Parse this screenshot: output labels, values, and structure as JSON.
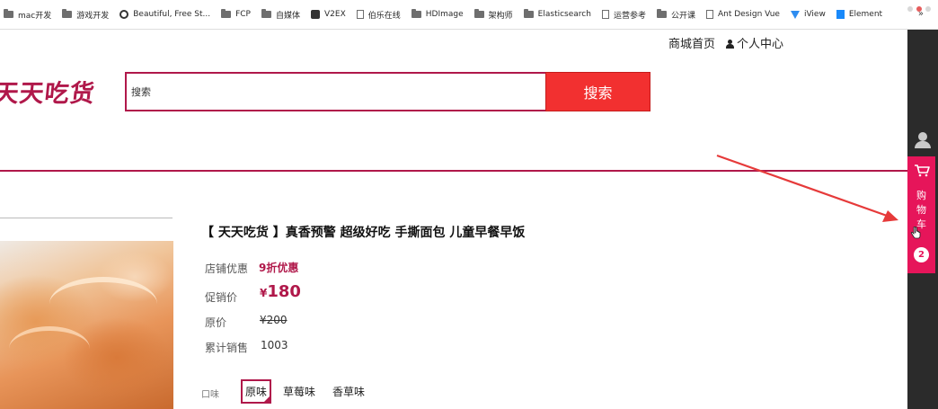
{
  "bookmarks": [
    {
      "label": "mac开发",
      "icon": "folder-icon"
    },
    {
      "label": "游戏开发",
      "icon": "folder-icon"
    },
    {
      "label": "Beautiful, Free St...",
      "icon": "ring-icon"
    },
    {
      "label": "FCP",
      "icon": "folder-icon"
    },
    {
      "label": "自媒体",
      "icon": "folder-icon"
    },
    {
      "label": "V2EX",
      "icon": "v2ex-icon"
    },
    {
      "label": "伯乐在线",
      "icon": "page-icon"
    },
    {
      "label": "HDImage",
      "icon": "folder-icon"
    },
    {
      "label": "架构师",
      "icon": "folder-icon"
    },
    {
      "label": "Elasticsearch",
      "icon": "folder-icon"
    },
    {
      "label": "运营参考",
      "icon": "page-icon"
    },
    {
      "label": "公开课",
      "icon": "folder-icon"
    },
    {
      "label": "Ant Design Vue",
      "icon": "page-icon"
    },
    {
      "label": "iView",
      "icon": "vue-icon"
    },
    {
      "label": "Element",
      "icon": "cube-icon"
    }
  ],
  "bookmarks_more": "»",
  "header": {
    "mall_home": "商城首页",
    "personal_center": "个人中心"
  },
  "logo": {
    "text": "天天吃货"
  },
  "search": {
    "placeholder": "搜索",
    "button": "搜索"
  },
  "product": {
    "title": "【 天天吃货 】真香预警 超级好吃 手撕面包 儿童早餐早饭",
    "store_promo_label": "店铺优惠",
    "store_promo_value": "9折优惠",
    "promo_price_label": "促销价",
    "currency": "¥",
    "promo_price": "180",
    "original_price_label": "原价",
    "original_price": "¥200",
    "sales_label": "累计销售",
    "sales_value": "1003",
    "flavor_label": "口味",
    "flavors": [
      "原味",
      "草莓味",
      "香草味"
    ],
    "selected_flavor": "原味"
  },
  "sidebar": {
    "cart_label": [
      "购",
      "物",
      "车"
    ],
    "cart_count": "2"
  },
  "colors": {
    "brand": "#b0184a",
    "search_button": "#f23030",
    "cart_bar": "#e6155a",
    "toolbar": "#2b2b2b",
    "annotation_arrow": "#e63a3a"
  }
}
